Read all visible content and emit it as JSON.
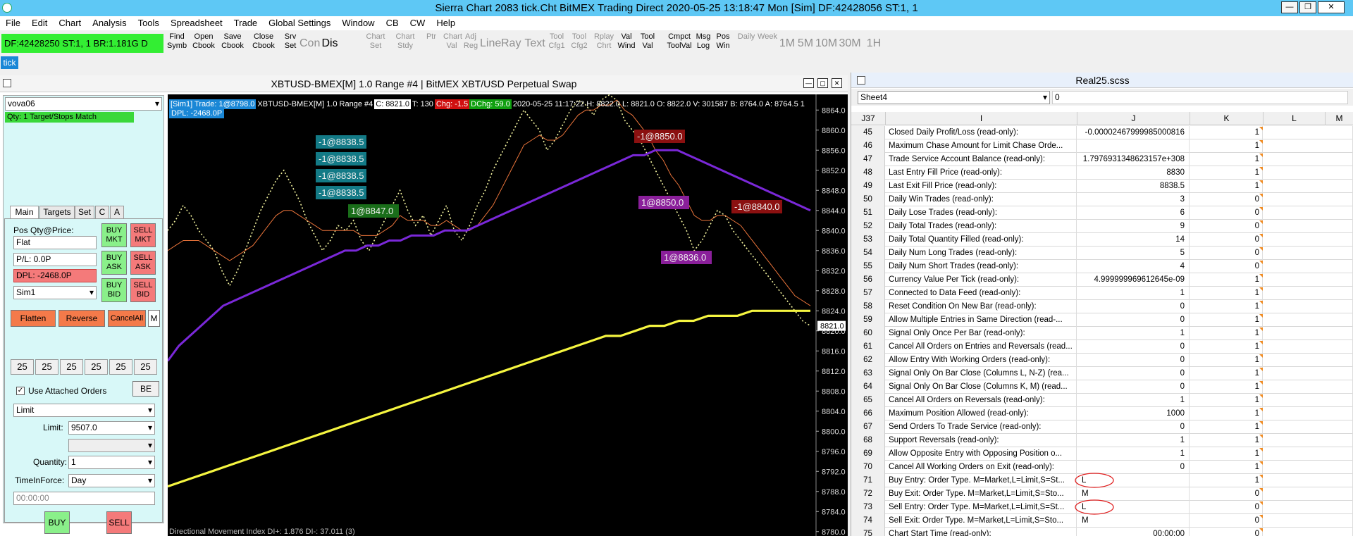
{
  "window": {
    "title": "Sierra Chart 2083 tick.Cht  BitMEX Trading Direct 2020-05-25  13:18:47 Mon [Sim]  DF:42428056  ST:1, 1"
  },
  "menu": [
    "File",
    "Edit",
    "Chart",
    "Analysis",
    "Tools",
    "Spreadsheet",
    "Trade",
    "Global Settings",
    "Window",
    "CB",
    "CW",
    "Help"
  ],
  "toolbar": {
    "df_status": "DF:42428250  ST:1, 1   BR:1.181G  D",
    "buttons": [
      {
        "label": "Find\nSymb",
        "enabled": true
      },
      {
        "label": "Open\nCbook",
        "enabled": true
      },
      {
        "label": "Save\nCbook",
        "enabled": true
      },
      {
        "label": "Close\nCbook",
        "enabled": true
      },
      {
        "label": "Srv\nSet",
        "enabled": true
      },
      {
        "label": "Con",
        "enabled": false,
        "big": true
      },
      {
        "label": "Dis",
        "enabled": true,
        "big": true
      },
      {
        "label": "Chart\nSet",
        "enabled": false
      },
      {
        "label": "Chart\nStdy",
        "enabled": false
      },
      {
        "label": "Ptr",
        "enabled": false
      },
      {
        "label": "Chart\nVal",
        "enabled": false
      },
      {
        "label": "Adj\nReg",
        "enabled": false
      },
      {
        "label": "Line",
        "enabled": false,
        "big": true
      },
      {
        "label": "Ray",
        "enabled": false,
        "big": true
      },
      {
        "label": "Text",
        "enabled": false,
        "big": true
      },
      {
        "label": "Tool\nCfg1",
        "enabled": false
      },
      {
        "label": "Tool\nCfg2",
        "enabled": false
      },
      {
        "label": "Rplay\nChrt",
        "enabled": false
      },
      {
        "label": "Val\nWind",
        "enabled": true
      },
      {
        "label": "Tool\nVal",
        "enabled": true
      },
      {
        "label": "Cmpct\nToolVal",
        "enabled": true
      },
      {
        "label": "Msg\nLog",
        "enabled": true
      },
      {
        "label": "Pos\nWin",
        "enabled": true
      },
      {
        "label": "Daily",
        "enabled": false
      },
      {
        "label": "Week",
        "enabled": false
      },
      {
        "label": "1M",
        "enabled": false,
        "big": true
      },
      {
        "label": "5M",
        "enabled": false,
        "big": true
      },
      {
        "label": "10M",
        "enabled": false,
        "big": true
      },
      {
        "label": "30M",
        "enabled": false,
        "big": true
      },
      {
        "label": "1H",
        "enabled": false,
        "big": true
      }
    ]
  },
  "tick_tab": "tick",
  "chart": {
    "title": "XBTUSD-BMEX[M]  1.0 Range  #4 | BitMEX XBT/USD Perpetual Swap",
    "info_sim": "[Sim1]  Trade: 1@8798.0",
    "info_sym": "XBTUSD-BMEX[M]  1.0 Range  #4",
    "info_c": "C: 8821.0",
    "info_t": "T: 130",
    "info_chg": "Chg: -1.5",
    "info_dchg": "DChg: 59.0",
    "info_rest": "2020-05-25 11:17:22  H: 8822.0  L: 8821.0  O: 8822.0  V: 301587  B: 8764.0  A: 8764.5  1",
    "dpl": "DPL: -2468.0P",
    "last_price": "8821.0",
    "footer": "Directional Movement Index  DI+: 1.876  DI-: 37.011  (3)",
    "colors": {
      "price": "#f5f5a0",
      "ema_fast": "#e8733a",
      "ma_mid": "#7a28d8",
      "ma_slow": "#f5f540"
    },
    "labels": [
      {
        "text": "-1@8838.5",
        "color": "#137a86"
      },
      {
        "text": "-1@8838.5",
        "color": "#137a86"
      },
      {
        "text": "-1@8838.5",
        "color": "#137a86"
      },
      {
        "text": "-1@8838.5",
        "color": "#137a86"
      },
      {
        "text": "1@8847.0",
        "color": "#1a6e1a"
      },
      {
        "text": "1@8850.0",
        "color": "#8a1f9a"
      },
      {
        "text": "1@8836.0",
        "color": "#8a1f9a"
      },
      {
        "text": "-1@8850.0",
        "color": "#8b1010"
      },
      {
        "text": "-1@8840.0",
        "color": "#8b1010"
      }
    ]
  },
  "chart_data": {
    "type": "line",
    "ylim": [
      8778,
      8866
    ],
    "yticks": [
      "8864.0",
      "8860.0",
      "8856.0",
      "8852.0",
      "8848.0",
      "8844.0",
      "8840.0",
      "8836.0",
      "8832.0",
      "8828.0",
      "8824.0",
      "8820.0",
      "8816.0",
      "8812.0",
      "8808.0",
      "8804.0",
      "8800.0",
      "8796.0",
      "8792.0",
      "8788.0",
      "8784.0",
      "8780.0"
    ],
    "series": [
      {
        "values": [
          8840,
          8842,
          8845,
          8843,
          8840,
          8838,
          8836,
          8832,
          8829,
          8832,
          8836,
          8840,
          8844,
          8847,
          8850,
          8852,
          8849,
          8846,
          8842,
          8839,
          8836,
          8838,
          8841,
          8840,
          8842,
          8838,
          8836,
          8839,
          8842,
          8845,
          8848,
          8844,
          8841,
          8843,
          8839,
          8842,
          8845,
          8840,
          8838,
          8841,
          8845,
          8848,
          8852,
          8855,
          8858,
          8861,
          8864,
          8862,
          8860,
          8856,
          8858,
          8861,
          8864,
          8866,
          8865,
          8863,
          8866,
          8867,
          8866,
          8862,
          8860,
          8858,
          8855,
          8852,
          8849,
          8846,
          8843,
          8840,
          8836,
          8838,
          8841,
          8844,
          8843,
          8840,
          8838,
          8836,
          8834,
          8832,
          8830,
          8828,
          8826,
          8824,
          8822,
          8821
        ]
      },
      {
        "values": [
          8836,
          8837,
          8838,
          8838,
          8838,
          8837,
          8836,
          8835,
          8834,
          8835,
          8836,
          8837,
          8839,
          8841,
          8843,
          8844,
          8844,
          8843,
          8842,
          8841,
          8840,
          8840,
          8840,
          8840,
          8840,
          8839,
          8839,
          8839,
          8840,
          8841,
          8843,
          8842,
          8842,
          8842,
          8841,
          8841,
          8842,
          8841,
          8840,
          8840,
          8841,
          8843,
          8845,
          8848,
          8851,
          8854,
          8857,
          8858,
          8859,
          8858,
          8858,
          8859,
          8861,
          8863,
          8864,
          8864,
          8865,
          8865,
          8866,
          8864,
          8863,
          8861,
          8859,
          8856,
          8854,
          8851,
          8849,
          8846,
          8843,
          8842,
          8842,
          8843,
          8843,
          8842,
          8841,
          8839,
          8837,
          8835,
          8833,
          8831,
          8829,
          8827,
          8826,
          8825
        ]
      },
      {
        "values": [
          8814,
          8817,
          8819,
          8821,
          8823,
          8825,
          8826,
          8827,
          8828,
          8829,
          8830,
          8831,
          8832,
          8833,
          8834,
          8835,
          8836,
          8836,
          8837,
          8837,
          8838,
          8838,
          8839,
          8839,
          8839,
          8840,
          8840,
          8840,
          8841,
          8842,
          8843,
          8844,
          8845,
          8846,
          8847,
          8848,
          8849,
          8850,
          8851,
          8852,
          8853,
          8854,
          8855,
          8855,
          8856,
          8856,
          8856,
          8855,
          8854,
          8853,
          8852,
          8851,
          8850,
          8849,
          8848,
          8847,
          8846,
          8845,
          8844
        ]
      },
      {
        "values": [
          8789,
          8790,
          8791,
          8792,
          8793,
          8794,
          8795,
          8796,
          8797,
          8798,
          8799,
          8800,
          8801,
          8802,
          8803,
          8804,
          8805,
          8806,
          8807,
          8808,
          8809,
          8810,
          8811,
          8812,
          8813,
          8814,
          8815,
          8816,
          8817,
          8818,
          8819,
          8819,
          8820,
          8821,
          8821,
          8822,
          8822,
          8823,
          8823,
          8823,
          8824,
          8824,
          8824,
          8824,
          8824
        ]
      }
    ]
  },
  "tradewin": {
    "account": "vova06",
    "status": "Qty: 1 Target/Stops Match",
    "tabs": [
      "Main",
      "Targets",
      "Set",
      "C",
      "A"
    ],
    "pos_label": "Pos Qty@Price:",
    "pos_value": "Flat",
    "pl": "P/L: 0.0P",
    "dpl": "DPL: -2468.0P",
    "sim": "Sim1",
    "buy_mkt": "BUY\nMKT",
    "sell_mkt": "SELL\nMKT",
    "buy_ask": "BUY\nASK",
    "sell_ask": "SELL\nASK",
    "buy_bid": "BUY\nBID",
    "sell_bid": "SELL\nBID",
    "flatten": "Flatten",
    "reverse": "Reverse",
    "cancel_all": "CancelAll",
    "m": "M",
    "qty_buttons": [
      "25",
      "25",
      "25",
      "25",
      "25",
      "25"
    ],
    "use_attached": "Use Attached Orders",
    "be": "BE",
    "order_type": "Limit",
    "limit_label": "Limit:",
    "limit_value": "9507.0",
    "quantity_label": "Quantity:",
    "quantity_value": "1",
    "tif_label": "TimeInForce:",
    "tif_value": "Day",
    "time_value": "00:00:00",
    "buy": "BUY",
    "sell": "SELL"
  },
  "sheet": {
    "title": "Real25.scss",
    "sheet_name": "Sheet4",
    "formula": "0",
    "cell_ref": "J37",
    "columns": [
      "I",
      "J",
      "K",
      "L",
      "M"
    ],
    "rows": [
      {
        "n": "45",
        "i": "Closed Daily Profit/Loss (read-only):",
        "j": "-0.00002467999985000816",
        "k": "1"
      },
      {
        "n": "46",
        "i": "Maximum Chase Amount for Limit Chase Orde...",
        "j": "",
        "k": "1"
      },
      {
        "n": "47",
        "i": "Trade Service Account Balance (read-only):",
        "j": "1.7976931348623157e+308",
        "k": "1"
      },
      {
        "n": "48",
        "i": "Last Entry Fill Price (read-only):",
        "j": "8830",
        "k": "1"
      },
      {
        "n": "49",
        "i": "Last Exit Fill Price (read-only):",
        "j": "8838.5",
        "k": "1"
      },
      {
        "n": "50",
        "i": "Daily Win Trades (read-only):",
        "j": "3",
        "k": "0"
      },
      {
        "n": "51",
        "i": "Daily Lose Trades (read-only):",
        "j": "6",
        "k": "0"
      },
      {
        "n": "52",
        "i": "Daily Total Trades (read-only):",
        "j": "9",
        "k": "0"
      },
      {
        "n": "53",
        "i": "Daily Total Quantity Filled (read-only):",
        "j": "14",
        "k": "0"
      },
      {
        "n": "54",
        "i": "Daily Num Long Trades (read-only):",
        "j": "5",
        "k": "0"
      },
      {
        "n": "55",
        "i": "Daily Num Short Trades (read-only):",
        "j": "4",
        "k": "0"
      },
      {
        "n": "56",
        "i": "Currency Value Per Tick (read-only):",
        "j": "4.999999969612645e-09",
        "k": "1"
      },
      {
        "n": "57",
        "i": "Connected to Data Feed (read-only):",
        "j": "1",
        "k": "1"
      },
      {
        "n": "58",
        "i": "Reset Condition On New Bar (read-only):",
        "j": "0",
        "k": "1"
      },
      {
        "n": "59",
        "i": "Allow Multiple Entries in Same Direction (read-...",
        "j": "0",
        "k": "1"
      },
      {
        "n": "60",
        "i": "Signal Only Once Per Bar (read-only):",
        "j": "1",
        "k": "1"
      },
      {
        "n": "61",
        "i": "Cancel All Orders on Entries and Reversals (read...",
        "j": "0",
        "k": "1"
      },
      {
        "n": "62",
        "i": "Allow Entry With Working Orders (read-only):",
        "j": "0",
        "k": "1"
      },
      {
        "n": "63",
        "i": "Signal Only On Bar Close (Columns L, N-Z) (rea...",
        "j": "0",
        "k": "1"
      },
      {
        "n": "64",
        "i": "Signal Only On Bar Close (Columns K, M) (read...",
        "j": "0",
        "k": "1"
      },
      {
        "n": "65",
        "i": "Cancel All Orders on Reversals (read-only):",
        "j": "1",
        "k": "1"
      },
      {
        "n": "66",
        "i": "Maximum Position Allowed (read-only):",
        "j": "1000",
        "k": "1"
      },
      {
        "n": "67",
        "i": "Send Orders To Trade Service (read-only):",
        "j": "0",
        "k": "1"
      },
      {
        "n": "68",
        "i": "Support Reversals (read-only):",
        "j": "1",
        "k": "1"
      },
      {
        "n": "69",
        "i": "Allow Opposite Entry with Opposing Position o...",
        "j": "1",
        "k": "1"
      },
      {
        "n": "70",
        "i": "Cancel All Working Orders on Exit (read-only):",
        "j": "0",
        "k": "1"
      },
      {
        "n": "71",
        "i": "Buy Entry: Order Type. M=Market,L=Limit,S=St...",
        "j": "L",
        "k": "1",
        "left": true,
        "circled": true
      },
      {
        "n": "72",
        "i": "Buy Exit: Order Type. M=Market,L=Limit,S=Sto...",
        "j": "M",
        "k": "0",
        "left": true
      },
      {
        "n": "73",
        "i": "Sell Entry: Order Type. M=Market,L=Limit,S=St...",
        "j": "L",
        "k": "0",
        "left": true,
        "circled": true
      },
      {
        "n": "74",
        "i": "Sell Exit: Order Type. M=Market,L=Limit,S=Sto...",
        "j": "M",
        "k": "0",
        "left": true
      },
      {
        "n": "75",
        "i": "Chart Start Time (read-only):",
        "j": "00:00:00",
        "k": "0"
      }
    ]
  }
}
